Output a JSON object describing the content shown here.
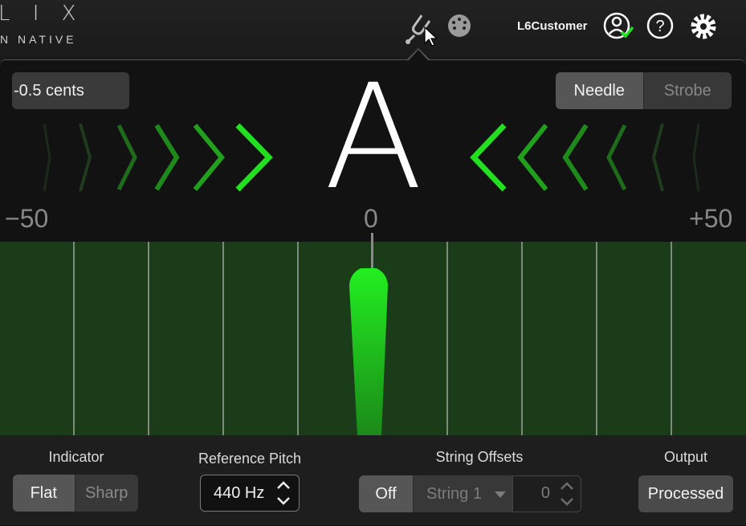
{
  "header": {
    "logo_text": "L I X",
    "logo_sub": "N NATIVE",
    "user_name": "L6Customer"
  },
  "tuner": {
    "cents_display": "-0.5 cents",
    "mode_options": [
      "Needle",
      "Strobe"
    ],
    "mode_selected": "Needle",
    "note": "A",
    "scale_min": "−50",
    "scale_center": "0",
    "scale_max": "+50",
    "needle_offset_cents": -0.5
  },
  "controls": {
    "indicator_label": "Indicator",
    "indicator_options": [
      "Flat",
      "Sharp"
    ],
    "indicator_selected": "Flat",
    "reference_pitch_label": "Reference Pitch",
    "reference_pitch_value": "440 Hz",
    "string_offsets_label": "String Offsets",
    "string_offsets_toggle": "Off",
    "string_select": "String 1",
    "string_offset_value": "0",
    "output_label": "Output",
    "output_value": "Processed"
  },
  "colors": {
    "accent_green": "#22e01f",
    "meter_bg": "#1a3c19"
  }
}
